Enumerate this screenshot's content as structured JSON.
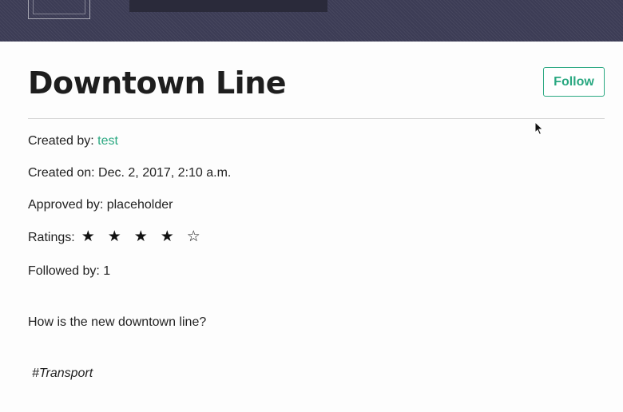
{
  "post": {
    "title": "Downtown Line",
    "follow_label": "Follow",
    "created_by_label": "Created by: ",
    "created_by_user": "test",
    "created_on": "Created on: Dec. 2, 2017, 2:10 a.m.",
    "approved_by": "Approved by: placeholder",
    "ratings_label": "Ratings:",
    "rating": {
      "value": 4,
      "max": 5
    },
    "stars": [
      "★",
      "★",
      "★",
      "★",
      "☆"
    ],
    "followed_by": "Followed by: 1",
    "body": "How is the new downtown line?",
    "hashtag": "#Transport"
  },
  "colors": {
    "accent": "#2aa881",
    "header_bg": "#3c3c55"
  }
}
